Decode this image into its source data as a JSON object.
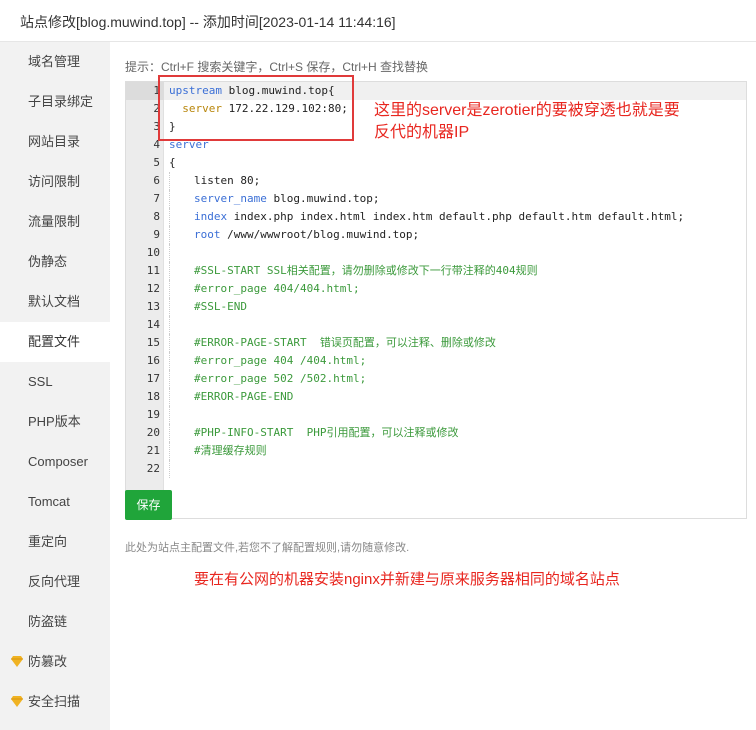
{
  "window": {
    "title": "站点修改[blog.muwind.top] -- 添加时间[2023-01-14 11:44:16]"
  },
  "sidebar": {
    "items": [
      {
        "label": "域名管理"
      },
      {
        "label": "子目录绑定"
      },
      {
        "label": "网站目录"
      },
      {
        "label": "访问限制"
      },
      {
        "label": "流量限制"
      },
      {
        "label": "伪静态"
      },
      {
        "label": "默认文档"
      },
      {
        "label": "配置文件",
        "active": true
      },
      {
        "label": "SSL"
      },
      {
        "label": "PHP版本"
      },
      {
        "label": "Composer"
      },
      {
        "label": "Tomcat"
      },
      {
        "label": "重定向"
      },
      {
        "label": "反向代理"
      },
      {
        "label": "防盗链"
      },
      {
        "label": "防篡改",
        "icon": "diamond-icon"
      },
      {
        "label": "安全扫描",
        "icon": "diamond-icon"
      }
    ]
  },
  "main": {
    "tip": "提示：Ctrl+F 搜索关键字，Ctrl+S 保存，Ctrl+H 查找替换",
    "save_label": "保存",
    "note": "此处为站点主配置文件,若您不了解配置规则,请勿随意修改.",
    "annotation_top_line1": "这里的server是zerotier的要被穿透也就是要",
    "annotation_top_line2": "反代的机器IP",
    "annotation_bottom": "要在有公网的机器安装nginx并新建与原来服务器相同的域名站点"
  },
  "editor": {
    "lines": [
      {
        "n": "1",
        "indent": 0,
        "parts": [
          {
            "t": "upstream",
            "c": "kw"
          },
          {
            "t": " blog.muwind.top{",
            "c": ""
          }
        ]
      },
      {
        "n": "2",
        "indent": 0,
        "parts": [
          {
            "t": "  ",
            "c": ""
          },
          {
            "t": "server",
            "c": "kw2"
          },
          {
            "t": " 172.22.129.102:80;",
            "c": ""
          }
        ]
      },
      {
        "n": "3",
        "indent": 0,
        "parts": [
          {
            "t": "}",
            "c": ""
          }
        ]
      },
      {
        "n": "4",
        "indent": 0,
        "parts": [
          {
            "t": "server",
            "c": "kw"
          }
        ]
      },
      {
        "n": "5",
        "indent": 0,
        "parts": [
          {
            "t": "{",
            "c": ""
          }
        ]
      },
      {
        "n": "6",
        "indent": 1,
        "parts": [
          {
            "t": "listen 80;",
            "c": ""
          }
        ]
      },
      {
        "n": "7",
        "indent": 1,
        "parts": [
          {
            "t": "server_name",
            "c": "kw"
          },
          {
            "t": " blog.muwind.top;",
            "c": ""
          }
        ]
      },
      {
        "n": "8",
        "indent": 1,
        "parts": [
          {
            "t": "index",
            "c": "kw"
          },
          {
            "t": " index.php index.html index.htm default.php default.htm default.html;",
            "c": ""
          }
        ]
      },
      {
        "n": "9",
        "indent": 1,
        "parts": [
          {
            "t": "root",
            "c": "kw"
          },
          {
            "t": " /www/wwwroot/blog.muwind.top;",
            "c": ""
          }
        ]
      },
      {
        "n": "10",
        "indent": 1,
        "parts": []
      },
      {
        "n": "11",
        "indent": 1,
        "parts": [
          {
            "t": "#SSL-START SSL相关配置，请勿删除或修改下一行带注释的404规则",
            "c": "cm"
          }
        ]
      },
      {
        "n": "12",
        "indent": 1,
        "parts": [
          {
            "t": "#error_page 404/404.html;",
            "c": "cm"
          }
        ]
      },
      {
        "n": "13",
        "indent": 1,
        "parts": [
          {
            "t": "#SSL-END",
            "c": "cm"
          }
        ]
      },
      {
        "n": "14",
        "indent": 1,
        "parts": []
      },
      {
        "n": "15",
        "indent": 1,
        "parts": [
          {
            "t": "#ERROR-PAGE-START  错误页配置，可以注释、删除或修改",
            "c": "cm"
          }
        ]
      },
      {
        "n": "16",
        "indent": 1,
        "parts": [
          {
            "t": "#error_page 404 /404.html;",
            "c": "cm"
          }
        ]
      },
      {
        "n": "17",
        "indent": 1,
        "parts": [
          {
            "t": "#error_page 502 /502.html;",
            "c": "cm"
          }
        ]
      },
      {
        "n": "18",
        "indent": 1,
        "parts": [
          {
            "t": "#ERROR-PAGE-END",
            "c": "cm"
          }
        ]
      },
      {
        "n": "19",
        "indent": 1,
        "parts": []
      },
      {
        "n": "20",
        "indent": 1,
        "parts": [
          {
            "t": "#PHP-INFO-START  PHP引用配置，可以注释或修改",
            "c": "cm"
          }
        ]
      },
      {
        "n": "21",
        "indent": 1,
        "parts": [
          {
            "t": "#清理缓存规则",
            "c": "cm"
          }
        ]
      },
      {
        "n": "22",
        "indent": 1,
        "parts": []
      }
    ]
  },
  "colors": {
    "accent_green": "#20a53a",
    "annotation_red": "#e8261f",
    "sidebar_bg": "#f2f2f2"
  }
}
